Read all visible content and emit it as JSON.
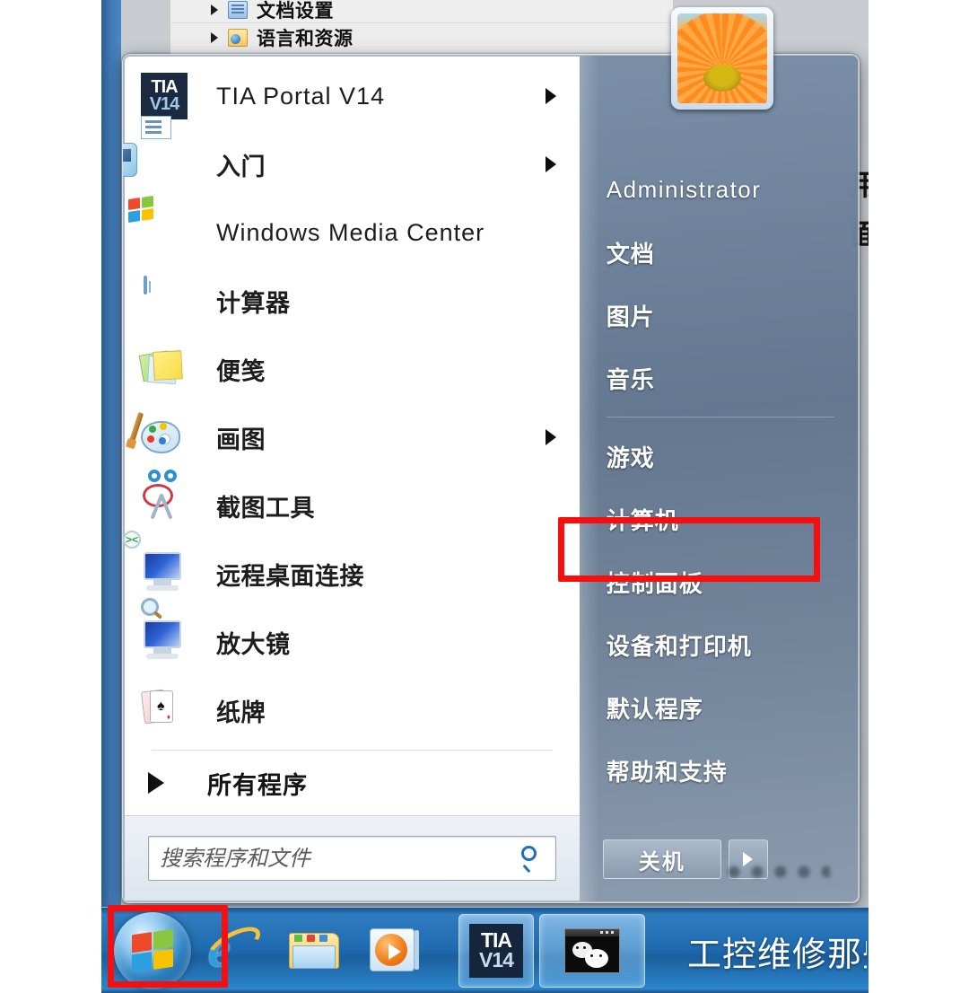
{
  "background_window": {
    "tree_items": [
      {
        "label": "文档设置",
        "icon": "document-settings-icon",
        "expander": "triangle-right"
      },
      {
        "label": "语言和资源",
        "icon": "folder-globe-icon",
        "expander": "triangle-right"
      }
    ],
    "clipped_text": [
      "用",
      "面"
    ]
  },
  "start_menu": {
    "left_panel": {
      "programs": [
        {
          "label": "TIA Portal V14",
          "icon": "tia-portal-v14-icon",
          "has_submenu": true,
          "script": "latin"
        },
        {
          "label": "入门",
          "icon": "getting-started-icon",
          "has_submenu": true,
          "script": "cjk"
        },
        {
          "label": "Windows Media Center",
          "icon": "windows-media-center-icon",
          "has_submenu": false,
          "script": "latin"
        },
        {
          "label": "计算器",
          "icon": "calculator-icon",
          "has_submenu": false,
          "script": "cjk"
        },
        {
          "label": "便笺",
          "icon": "sticky-notes-icon",
          "has_submenu": false,
          "script": "cjk"
        },
        {
          "label": "画图",
          "icon": "paint-icon",
          "has_submenu": true,
          "script": "cjk"
        },
        {
          "label": "截图工具",
          "icon": "snipping-tool-icon",
          "has_submenu": false,
          "script": "cjk"
        },
        {
          "label": "远程桌面连接",
          "icon": "remote-desktop-icon",
          "has_submenu": false,
          "script": "cjk"
        },
        {
          "label": "放大镜",
          "icon": "magnifier-icon",
          "has_submenu": false,
          "script": "cjk"
        },
        {
          "label": "纸牌",
          "icon": "solitaire-cards-icon",
          "has_submenu": false,
          "script": "cjk"
        }
      ],
      "all_programs_label": "所有程序",
      "search": {
        "placeholder": "搜索程序和文件",
        "value": "",
        "icon": "search-magnifier-icon"
      }
    },
    "right_panel": {
      "avatar_icon": "user-avatar-orange-flower",
      "user_name": "Administrator",
      "items_group_1": [
        "文档",
        "图片",
        "音乐"
      ],
      "items_group_2": [
        "游戏",
        "计算机",
        "控制面板",
        "设备和打印机",
        "默认程序",
        "帮助和支持"
      ],
      "shutdown": {
        "label": "关机",
        "arrow_icon": "chevron-right-icon"
      }
    }
  },
  "highlights": [
    {
      "target": "控制面板",
      "color": "#f50f0f",
      "name": "control-panel-highlight"
    },
    {
      "target": "开始按钮",
      "color": "#f50f0f",
      "name": "start-button-highlight"
    }
  ],
  "taskbar": {
    "start_button_icon": "windows-start-orb-icon",
    "buttons": [
      {
        "icon": "internet-explorer-icon",
        "label": "Internet Explorer",
        "state": "pinned"
      },
      {
        "icon": "windows-explorer-icon",
        "label": "Windows 资源管理器",
        "state": "pinned"
      },
      {
        "icon": "windows-media-player-icon",
        "label": "Windows Media Player",
        "state": "pinned"
      },
      {
        "icon": "tia-portal-v14-icon",
        "label": "TIA Portal V14",
        "state": "active"
      },
      {
        "icon": "console-window-icon",
        "label": "命令窗口",
        "state": "active"
      }
    ],
    "watermark": "工控维修那些事儿"
  },
  "colors": {
    "highlight_red": "#f50f0f",
    "taskbar_blue": "#1f6bb0",
    "start_menu_right": "#6b7f96",
    "tia_icon_navy": "#1b2a41"
  }
}
